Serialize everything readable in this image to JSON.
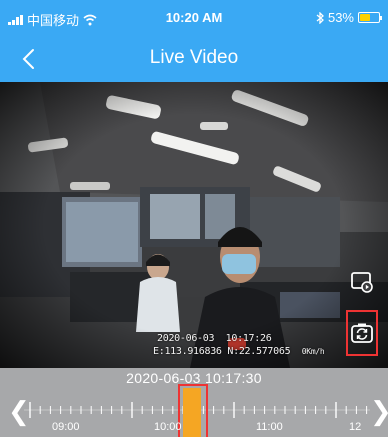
{
  "status_bar": {
    "carrier": "中国移动",
    "time": "10:20 AM",
    "battery_percent": "53%",
    "battery_level": 0.53,
    "icons": [
      "signal-icon",
      "wifi-icon",
      "bluetooth-icon",
      "battery-icon"
    ]
  },
  "nav": {
    "title": "Live Video",
    "back_icon": "chevron-left-icon"
  },
  "video": {
    "overlay_date": "2020-06-03",
    "overlay_time": "10:17:26",
    "overlay_lon": "E:113.916836",
    "overlay_lat": "N:22.577065",
    "overlay_speed": "0Km/h",
    "controls": [
      {
        "name": "playback-icon"
      },
      {
        "name": "switch-camera-icon"
      }
    ]
  },
  "timeline": {
    "current_datetime": "2020-06-03 10:17:30",
    "labels": [
      "09:00",
      "10:00",
      "11:00",
      "12"
    ],
    "left_arrow": "❮",
    "right_arrow": "❯"
  },
  "colors": {
    "header": "#3aa9f4",
    "timeline_bg": "#a7a8aa",
    "record_segment": "#f5a623",
    "highlight": "#ee3333"
  }
}
